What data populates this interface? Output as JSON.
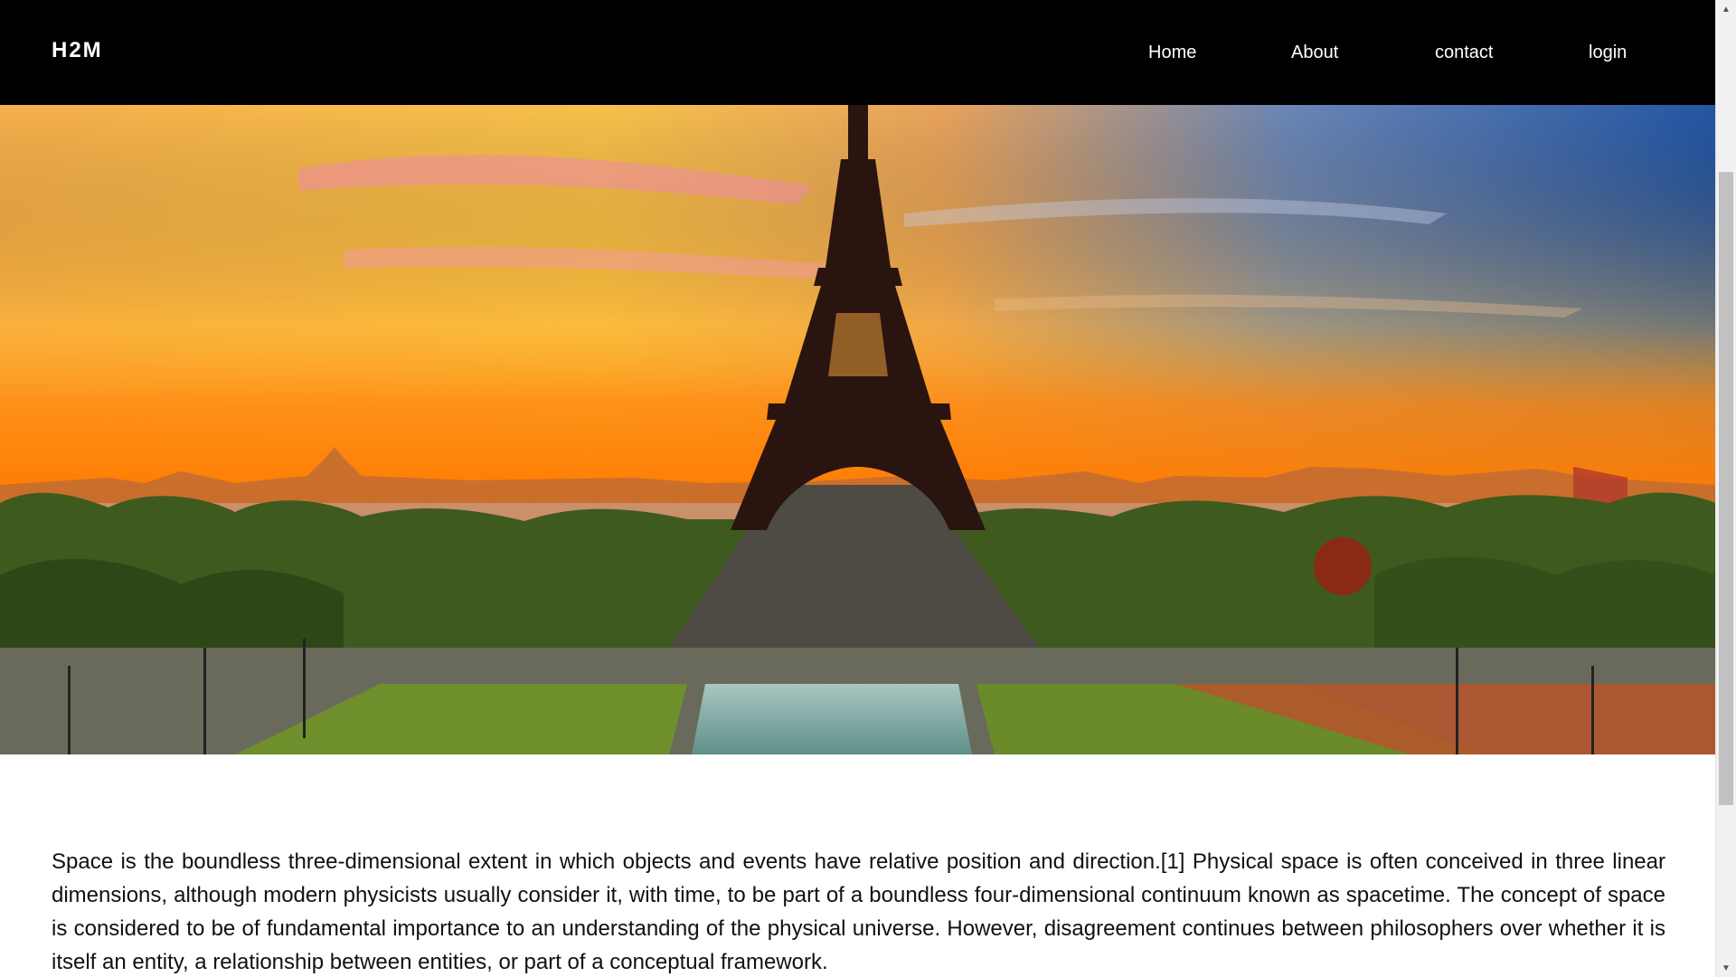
{
  "navbar": {
    "brand": "H2M",
    "items": [
      {
        "label": "Home"
      },
      {
        "label": "About"
      },
      {
        "label": "contact"
      },
      {
        "label": "login"
      }
    ]
  },
  "hero": {
    "image_subject": "Eiffel Tower at sunset over Paris",
    "colors": {
      "sky_top_left": "#f9b24a",
      "sky_top_right": "#2d5fa8",
      "horizon": "#ff8c1a",
      "tower": "#2a1410",
      "trees": "#3b5a1c",
      "grass": "#6e8f2a",
      "water": "#8fb7b0"
    }
  },
  "content": {
    "paragraph": "Space is the boundless three-dimensional extent in which objects and events have relative position and direction.[1] Physical space is often conceived in three linear dimensions, although modern physicists usually consider it, with time, to be part of a boundless four-dimensional continuum known as spacetime. The concept of space is considered to be of fundamental importance to an understanding of the physical universe. However, disagreement continues between philosophers over whether it is itself an entity, a relationship between entities, or part of a conceptual framework."
  },
  "scrollbar": {
    "up_icon": "▲",
    "down_icon": "▼"
  }
}
